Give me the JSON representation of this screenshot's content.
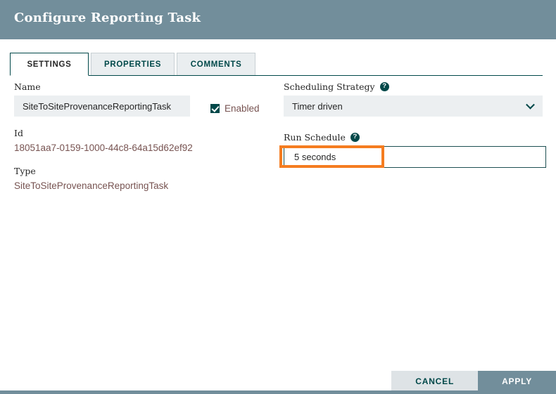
{
  "header": {
    "title": "Configure Reporting Task"
  },
  "tabs": [
    {
      "label": "SETTINGS",
      "active": true
    },
    {
      "label": "PROPERTIES",
      "active": false
    },
    {
      "label": "COMMENTS",
      "active": false
    }
  ],
  "settings": {
    "name": {
      "label": "Name",
      "value": "SiteToSiteProvenanceReportingTask",
      "placeholder": ""
    },
    "enabled": {
      "label": "Enabled",
      "checked": true
    },
    "id": {
      "label": "Id",
      "value": "18051aa7-0159-1000-44c8-64a15d62ef92"
    },
    "type": {
      "label": "Type",
      "value": "SiteToSiteProvenanceReportingTask"
    },
    "scheduling_strategy": {
      "label": "Scheduling Strategy",
      "help_icon": "help-icon",
      "selected": "Timer driven",
      "options": [
        "Timer driven"
      ]
    },
    "run_schedule": {
      "label": "Run Schedule",
      "help_icon": "help-icon",
      "value": "5 seconds",
      "placeholder": ""
    }
  },
  "footer": {
    "cancel_label": "CANCEL",
    "apply_label": "APPLY"
  },
  "colors": {
    "header_bg": "#728e9b",
    "accent_teal": "#004849",
    "value_text": "#775351",
    "input_bg": "#eceff1",
    "focus_orange": "#f57c20",
    "cancel_bg": "#dee3e6"
  },
  "icons": {
    "help": "?",
    "chevron_down": "chevron-down-icon",
    "checkmark": "check-icon"
  }
}
